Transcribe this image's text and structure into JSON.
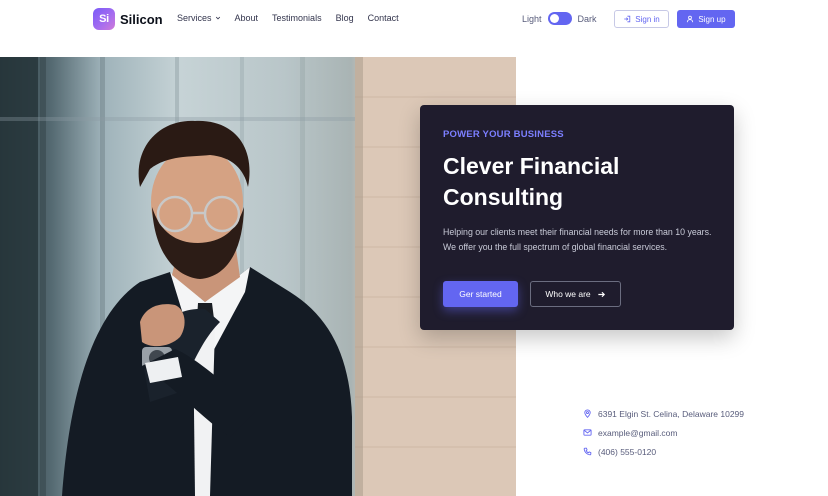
{
  "brand": {
    "mark": "Si",
    "name": "Silicon"
  },
  "nav": {
    "items": [
      {
        "label": "Services",
        "has_dropdown": true
      },
      {
        "label": "About"
      },
      {
        "label": "Testimonials"
      },
      {
        "label": "Blog"
      },
      {
        "label": "Contact"
      }
    ]
  },
  "mode": {
    "light_label": "Light",
    "dark_label": "Dark"
  },
  "auth": {
    "signin_label": "Sign in",
    "signup_label": "Sign up"
  },
  "hero": {
    "eyebrow": "POWER YOUR BUSINESS",
    "title_line1": "Clever Financial",
    "title_line2": "Consulting",
    "text": "Helping our clients meet their financial needs for more than 10 years. We offer you  the full spectrum of global financial services.",
    "primary_label": "Ger started",
    "secondary_label": "Who we are"
  },
  "contacts": {
    "address": "6391 Elgin St. Celina, Delaware 10299",
    "email": "example@gmail.com",
    "phone": "(406) 555-0120"
  },
  "colors": {
    "accent": "#6366f1",
    "card_bg": "#1f1c2d",
    "eyebrow": "#7c7fff"
  },
  "icons": {
    "address": "map-pin-icon",
    "email": "mail-icon",
    "phone": "phone-icon",
    "signin": "sign-in-icon",
    "signup": "user-icon",
    "secondary": "arrow-right-icon"
  }
}
